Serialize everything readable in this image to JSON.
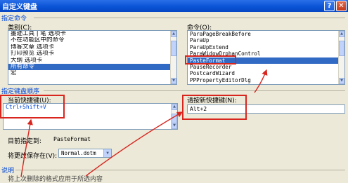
{
  "window": {
    "title": "自定义键盘",
    "help_glyph": "?",
    "close_glyph": "✕"
  },
  "commands_section": {
    "header": "指定命令",
    "categories_label": "类别(C):",
    "categories": [
      "墨迹工具 | 笔 选项卡",
      "不在功能区中的命令",
      "博客文章 选项卡",
      "打印预览 选项卡",
      "大纲 选项卡",
      "所有命令",
      "宏"
    ],
    "categories_selected": 5,
    "commands_label": "命令(O):",
    "commands": [
      "ParaPageBreakBefore",
      "ParaUp",
      "ParaUpExtend",
      "ParaWidowOrphanControl",
      "PasteFormat",
      "PauseRecorder",
      "PostcardWizard",
      "PPPropertyEditorDlg"
    ],
    "commands_selected": 4
  },
  "shortcut_section": {
    "header": "指定键盘顺序",
    "current_label": "当前快捷键(U):",
    "current_keys": [
      "Ctrl+Shift+V"
    ],
    "new_label": "请按新快捷键(N):",
    "new_key_value": "Alt+2",
    "assigned_label": "目前指定到:",
    "assigned_value": "PasteFormat",
    "save_label": "将更改保存在(V):",
    "save_value": "Normal.dotm"
  },
  "description_section": {
    "header": "说明",
    "text": "将上次删除的格式应用于所选内容"
  },
  "colors": {
    "accent": "#0046d5",
    "annotation": "#d8261f",
    "selection": "#316ac5"
  }
}
